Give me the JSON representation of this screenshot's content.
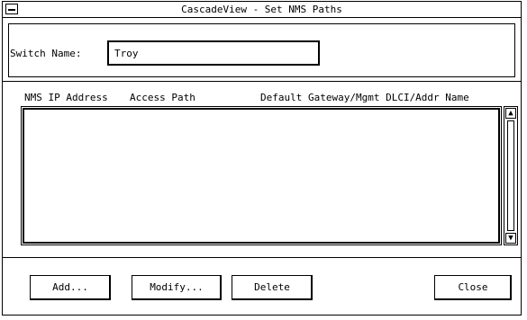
{
  "window": {
    "title": "CascadeView - Set NMS Paths"
  },
  "form": {
    "switch_name_label": "Switch Name:",
    "switch_name_value": "Troy"
  },
  "list": {
    "columns": [
      "NMS IP Address",
      "Access Path",
      "Default Gateway/Mgmt DLCI/Addr Name"
    ],
    "rows": []
  },
  "buttons": {
    "add": "Add...",
    "modify": "Modify...",
    "delete": "Delete",
    "close": "Close"
  },
  "scrollbar": {
    "up_glyph": "▲",
    "down_glyph": "▼"
  }
}
